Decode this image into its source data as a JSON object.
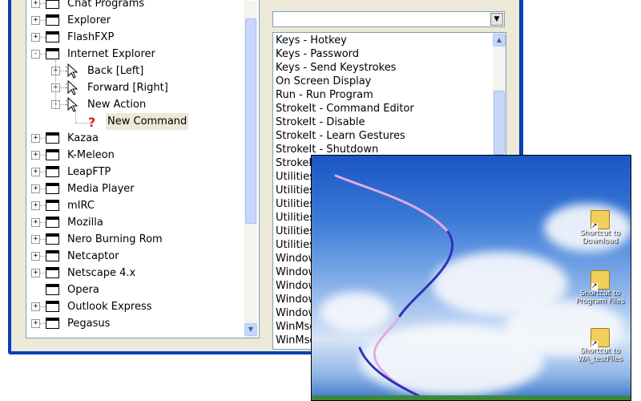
{
  "tree": {
    "items": [
      {
        "label": "Chat Programs",
        "expander": "+",
        "icon": "window-icon"
      },
      {
        "label": "Explorer",
        "expander": "+",
        "icon": "window-icon"
      },
      {
        "label": "FlashFXP",
        "expander": "+",
        "icon": "window-icon"
      },
      {
        "label": "Internet Explorer",
        "expander": "-",
        "icon": "window-icon"
      },
      {
        "label": "Back [Left]",
        "expander": "+",
        "icon": "mouse-gesture-icon",
        "child": true
      },
      {
        "label": "Forward [Right]",
        "expander": "+",
        "icon": "mouse-gesture-icon",
        "child": true
      },
      {
        "label": "New Action",
        "expander": "-",
        "icon": "mouse-gesture-icon",
        "child": true
      },
      {
        "label": "New Command",
        "expander": "",
        "icon": "question-icon",
        "grandchild": true,
        "selected": true
      },
      {
        "label": "Kazaa",
        "expander": "+",
        "icon": "window-icon"
      },
      {
        "label": "K-Meleon",
        "expander": "+",
        "icon": "window-icon"
      },
      {
        "label": "LeapFTP",
        "expander": "+",
        "icon": "window-icon"
      },
      {
        "label": "Media Player",
        "expander": "+",
        "icon": "window-icon"
      },
      {
        "label": "mIRC",
        "expander": "+",
        "icon": "window-icon"
      },
      {
        "label": "Mozilla",
        "expander": "+",
        "icon": "window-icon"
      },
      {
        "label": "Nero Burning Rom",
        "expander": "+",
        "icon": "window-icon"
      },
      {
        "label": "Netcaptor",
        "expander": "+",
        "icon": "window-icon"
      },
      {
        "label": "Netscape 4.x",
        "expander": "+",
        "icon": "window-icon"
      },
      {
        "label": "Opera",
        "expander": "",
        "icon": "window-icon"
      },
      {
        "label": "Outlook Express",
        "expander": "+",
        "icon": "window-icon"
      },
      {
        "label": "Pegasus",
        "expander": "+",
        "icon": "window-icon"
      }
    ]
  },
  "command_combo": {
    "value": "",
    "arrow": "▼"
  },
  "command_list": {
    "items": [
      "Keys - Hotkey",
      "Keys - Password",
      "Keys - Send Keystrokes",
      "On Screen Display",
      "Run - Run Program",
      "StrokeIt - Command Editor",
      "StrokeIt - Disable",
      "StrokeIt - Learn Gestures",
      "StrokeIt - Shutdown",
      "StrokeIt",
      "Utilities",
      "Utilities",
      "Utilities",
      "Utilities",
      "Utilities",
      "Utilities",
      "Window",
      "Window",
      "Window",
      "Window",
      "Window",
      "WinMsg",
      "WinMsg"
    ]
  },
  "scroll": {
    "up": "▲",
    "down": "▼"
  },
  "desktop": {
    "icons": [
      {
        "caption": "Shortcut to Download"
      },
      {
        "caption": "Shortcut to Program Files"
      },
      {
        "caption": "Shortcut to WA_testFiles"
      }
    ]
  },
  "colors": {
    "titlebar_blue": "#0a3fb7",
    "gesture_trail_dark": "#2a33b8",
    "gesture_trail_light": "#e5a8e8"
  }
}
